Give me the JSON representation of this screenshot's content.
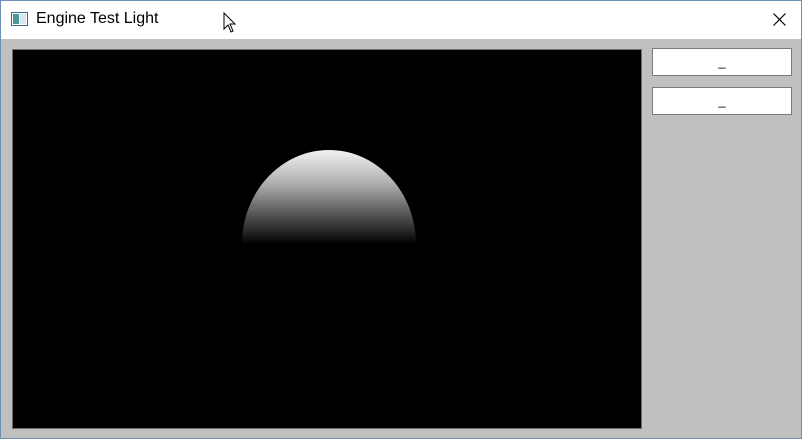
{
  "window": {
    "title": "Engine Test Light",
    "icons": {
      "app": "application-window-icon",
      "close": "close-icon",
      "cursor": "mouse-pointer-icon"
    }
  },
  "viewport": {
    "background_color": "#000000",
    "content": "shaded-sphere"
  },
  "side_panel": {
    "button_1_label": "_",
    "button_2_label": "_"
  },
  "colors": {
    "client_background": "#c0c0c0",
    "window_border": "#6b8fb5"
  }
}
